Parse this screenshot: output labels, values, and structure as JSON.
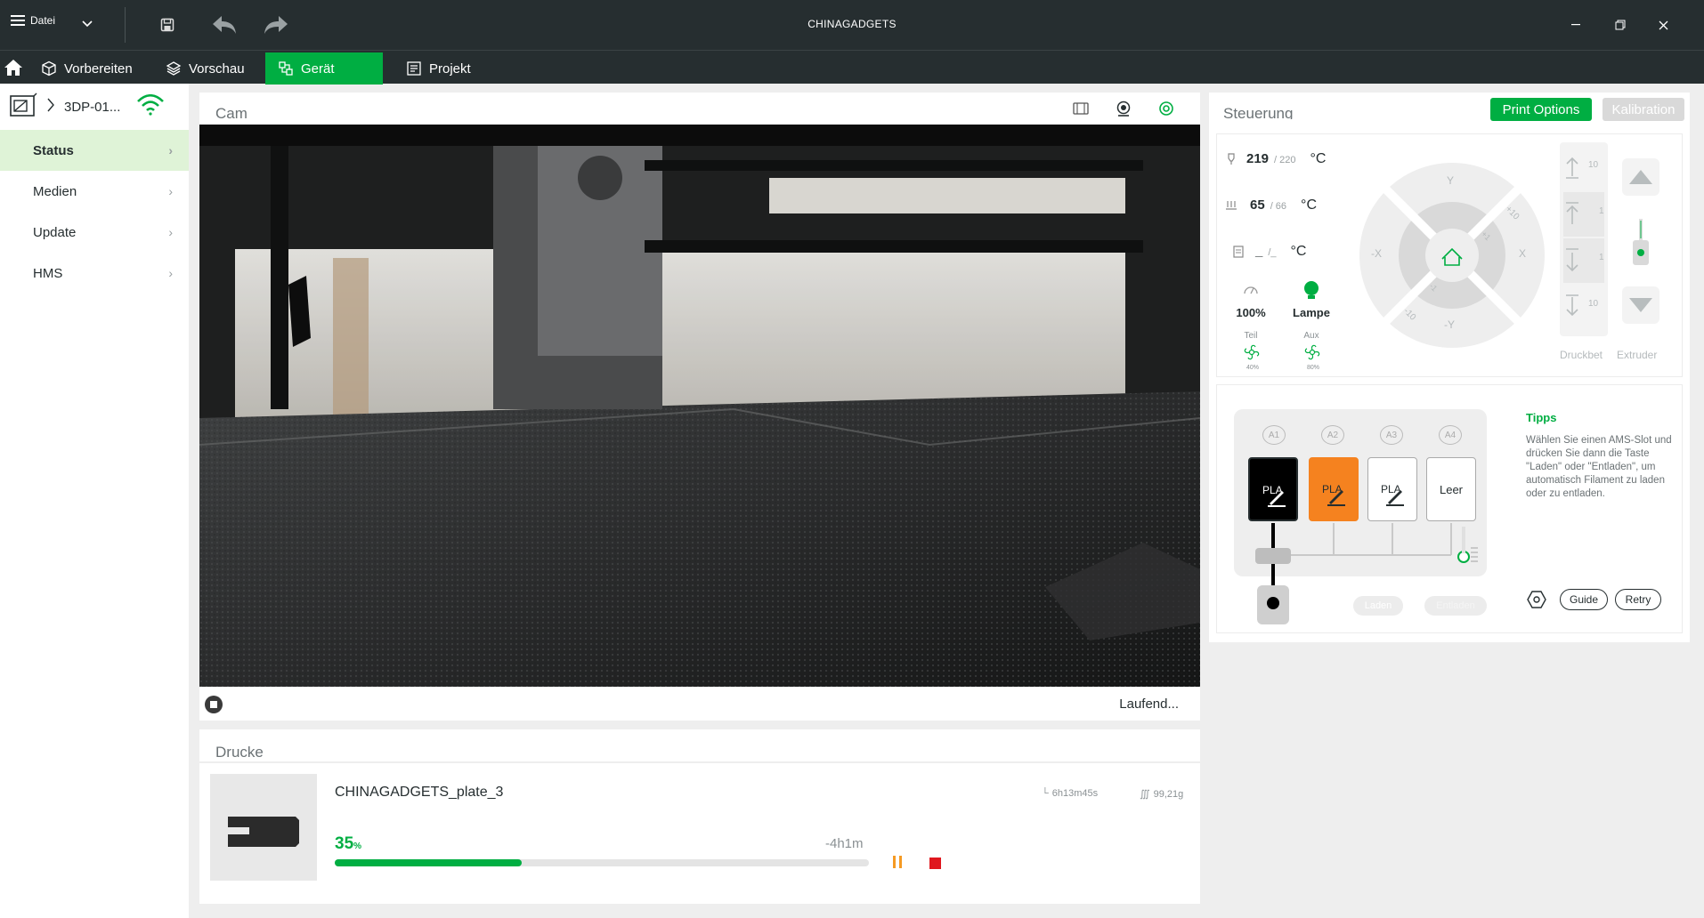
{
  "titlebar": {
    "menu_label": "Datei",
    "title": "CHINAGADGETS",
    "icons": [
      "save-icon",
      "undo-icon",
      "redo-icon"
    ],
    "window_controls": [
      "minimize",
      "restore",
      "close"
    ]
  },
  "nav": {
    "tabs": [
      {
        "label": "Vorbereiten",
        "icon": "cube-icon"
      },
      {
        "label": "Vorschau",
        "icon": "layers-icon"
      },
      {
        "label": "Gerät",
        "icon": "device-icon",
        "active": true
      },
      {
        "label": "Projekt",
        "icon": "project-icon"
      }
    ]
  },
  "sidebar": {
    "printer_name": "3DP-01...",
    "items": [
      {
        "label": "Status",
        "active": true
      },
      {
        "label": "Medien"
      },
      {
        "label": "Update"
      },
      {
        "label": "HMS"
      }
    ]
  },
  "camera": {
    "title": "Cam",
    "status": "Laufend..."
  },
  "print_job": {
    "title": "Drucke",
    "name": "CHINAGADGETS_plate_3",
    "time": "6h13m45s",
    "weight": "99,21g",
    "progress_pct": 35,
    "pct_label": "35",
    "pct_unit": "%",
    "remaining": "-4h1m"
  },
  "control": {
    "title": "Steuerung",
    "print_options": "Print Options",
    "kalibration": "Kalibration",
    "nozzle": {
      "current": "219",
      "target": "/ 220",
      "unit": "°C"
    },
    "bed": {
      "current": "65",
      "target": "/ 66",
      "unit": "°C"
    },
    "chamber": {
      "current": "_",
      "target": "/_",
      "unit": "°C"
    },
    "speed": "100%",
    "lamp": "Lampe",
    "fan_part": "Teil",
    "fan_aux": "Aux",
    "fan_part_val": "40%",
    "fan_aux_val": "80%",
    "jog": {
      "y": "Y",
      "ny": "-Y",
      "x": "X",
      "nx": "-X",
      "p10": "+10",
      "p1": "+1",
      "m1": "-1",
      "m10": "-10"
    },
    "z_steps": [
      "10",
      "1",
      "1",
      "10"
    ],
    "druckbett": "Druckbet",
    "extruder": "Extruder"
  },
  "ams": {
    "slots": [
      {
        "tag": "A1",
        "label": "PLA",
        "color": "#000000"
      },
      {
        "tag": "A2",
        "label": "PLA",
        "color": "#f5821f"
      },
      {
        "tag": "A3",
        "label": "PLA",
        "color": "#ffffff"
      },
      {
        "tag": "A4",
        "label": "Leer",
        "color": "#ffffff"
      }
    ],
    "laden": "Laden",
    "entladen": "Entladen",
    "tipps_title": "Tipps",
    "tipps_text": "Wählen Sie einen AMS-Slot und drücken Sie dann die Taste \"Laden\" oder \"Entladen\", um automatisch Filament zu laden oder zu entladen.",
    "guide": "Guide",
    "retry": "Retry"
  }
}
